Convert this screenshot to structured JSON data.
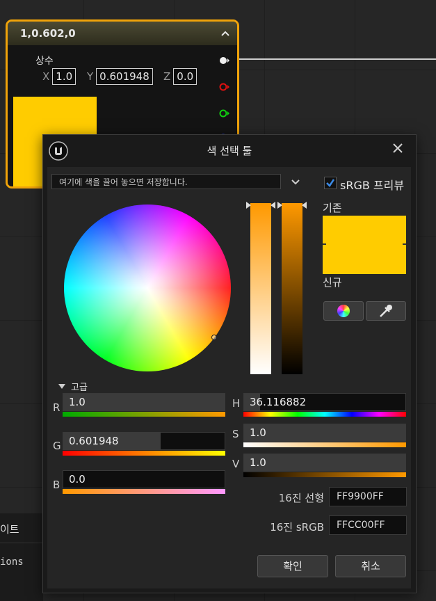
{
  "node": {
    "title": "1,0.602,0",
    "param_label": "상수",
    "x_label": "X",
    "x_value": "1.0",
    "y_label": "Y",
    "y_value": "0.601948",
    "z_label": "Z",
    "z_value": "0.0",
    "swatch_color": "#ffcc00"
  },
  "background_panel": {
    "text_top": "이트",
    "text_bottom": "ions"
  },
  "picker": {
    "title": "색 선택 툴",
    "drop_placeholder": "여기에 색을 끌어 놓으면 저장합니다.",
    "srgb_preview_label": "sRGB 프리뷰",
    "srgb_preview_checked": true,
    "old_label": "기존",
    "new_label": "신규",
    "old_color": "#ffcc00",
    "advanced_label": "고급",
    "channels": {
      "r": {
        "label": "R",
        "value": "1.0",
        "fraction": 1.0
      },
      "g": {
        "label": "G",
        "value": "0.601948",
        "fraction": 0.601948
      },
      "b": {
        "label": "B",
        "value": "0.0",
        "fraction": 0.0
      },
      "h": {
        "label": "H",
        "value": "36.116882",
        "fraction": 0.1
      },
      "s": {
        "label": "S",
        "value": "1.0",
        "fraction": 1.0
      },
      "v": {
        "label": "V",
        "value": "1.0",
        "fraction": 1.0
      }
    },
    "hex_linear_label": "16진 선형",
    "hex_linear_value": "FF9900FF",
    "hex_srgb_label": "16진 sRGB",
    "hex_srgb_value": "FFCC00FF",
    "ok_label": "확인",
    "cancel_label": "취소",
    "accent_color": "#ff9900"
  }
}
